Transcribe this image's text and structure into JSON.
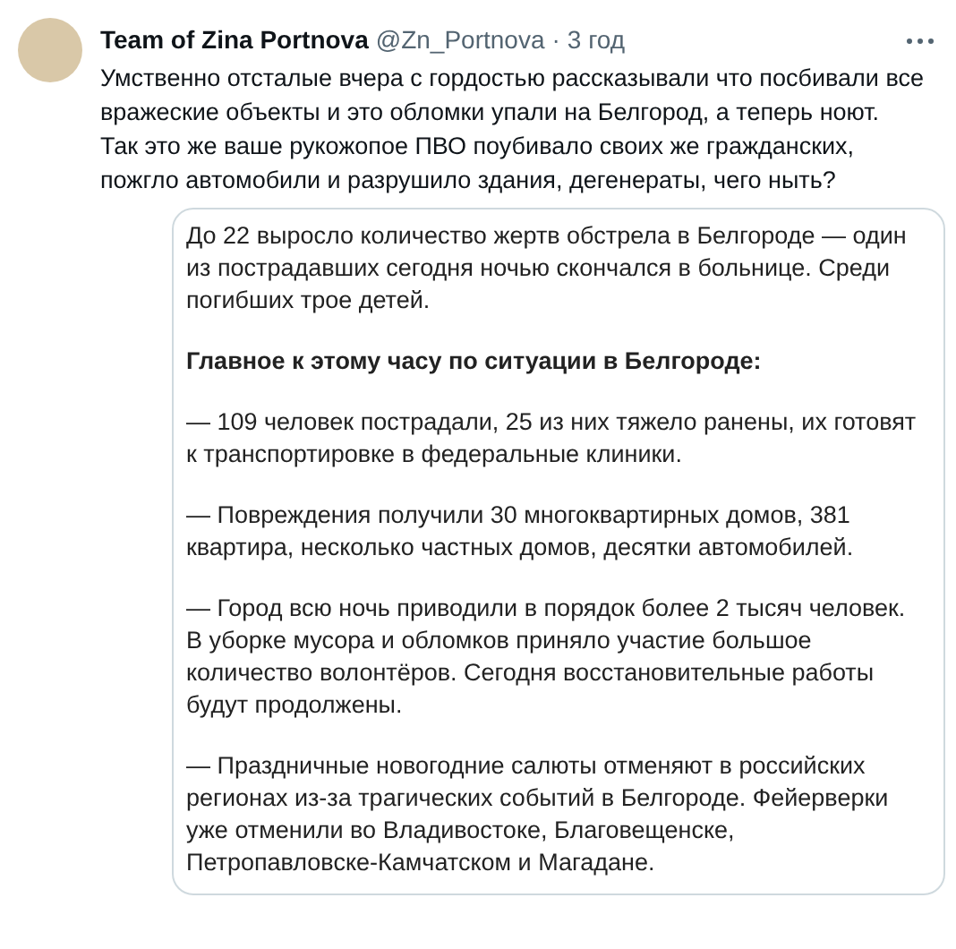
{
  "tweet": {
    "author": "Team of Zina Portnova",
    "handle": "@Zn_Portnova",
    "separator": "·",
    "time": "3 год",
    "text_lines": [
      "Умственно отсталые вчера с гордостью рассказывали что посбивали все",
      "вражеские объекты и это обломки упали на Белгород, а теперь ноют.",
      "Так это же ваше рукожопое ПВО поубивало своих же гражданских,",
      "пожгло автомобили и разрушило здания, дегенераты, чего ныть?"
    ]
  },
  "attached_screenshot": {
    "paragraphs": [
      {
        "kind": "plain",
        "lines": [
          "До 22 выросло количество жертв обстрела в Белгороде — один",
          "из пострадавших сегодня ночью скончался в больнице. Среди",
          "погибших трое детей."
        ]
      },
      {
        "kind": "heading",
        "lines": [
          "Главное к этому часу по ситуации в Белгороде:"
        ]
      },
      {
        "kind": "plain",
        "lines": [
          "— 109 человек пострадали, 25 из них тяжело ранены, их готовят",
          "к транспортировке в федеральные клиники."
        ]
      },
      {
        "kind": "plain",
        "lines": [
          "— Повреждения получили 30 многоквартирных домов, 381",
          "квартира, несколько частных домов, десятки автомобилей."
        ]
      },
      {
        "kind": "plain",
        "lines": [
          "— Город всю ночь приводили в порядок более 2 тысяч человек.",
          "В уборке мусора и обломков приняло участие большое",
          "количество волонтёров. Сегодня восстановительные работы",
          "будут продолжены."
        ]
      },
      {
        "kind": "plain",
        "lines": [
          "— Праздничные новогодние салюты отменяют в российских",
          "регионах из-за трагических событий в Белгороде. Фейерверки",
          "уже отменили во Владивостоке, Благовещенске,",
          "Петропавловске-Камчатском и Магадане."
        ]
      }
    ]
  }
}
